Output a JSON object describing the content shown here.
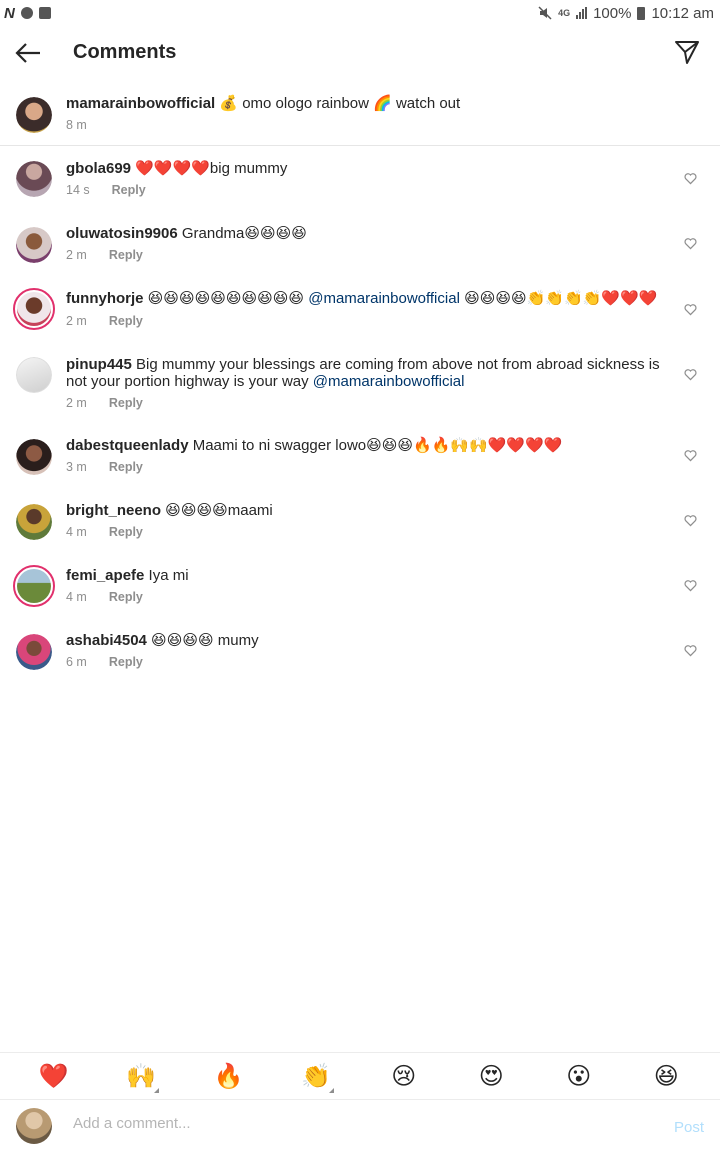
{
  "status_bar": {
    "left_icon_1": "N",
    "network": "4G",
    "battery": "100%",
    "time": "10:12 am"
  },
  "header": {
    "title": "Comments"
  },
  "caption": {
    "username": "mamarainbowofficial",
    "text": " 💰 omo ologo rainbow 🌈 watch out",
    "time": "8 m"
  },
  "comments": [
    {
      "username": "gbola699",
      "text": " ❤️❤️❤️❤️big mummy",
      "time": "14 s",
      "reply": "Reply"
    },
    {
      "username": "oluwatosin9906",
      "text": " Grandma😆😆😆😆",
      "time": "2 m",
      "reply": "Reply"
    },
    {
      "username": "funnyhorje",
      "text": " 😆😆😆😆😆😆😆😆😆😆 ",
      "mention": "@mamarainbowofficial",
      "text_after": " 😆😆😆😆👏👏👏👏❤️❤️❤️",
      "time": "2 m",
      "reply": "Reply"
    },
    {
      "username": "pinup445",
      "text": " Big mummy your blessings are coming from above not from abroad  sickness is not your portion highway is your way ",
      "mention": "@mamarainbowofficial",
      "time": "2 m",
      "reply": "Reply"
    },
    {
      "username": "dabestqueenlady",
      "text": " Maami to ni swagger lowo😆😆😆🔥🔥🙌🙌❤️❤️❤️❤️",
      "time": "3 m",
      "reply": "Reply"
    },
    {
      "username": "bright_neeno",
      "text": " 😆😆😆😆maami",
      "time": "4 m",
      "reply": "Reply"
    },
    {
      "username": "femi_apefe",
      "text": " Iya mi",
      "time": "4 m",
      "reply": "Reply"
    },
    {
      "username": "ashabi4504",
      "text": " 😆😆😆😆 mumy",
      "time": "6 m",
      "reply": "Reply"
    }
  ],
  "emoji_bar": [
    "❤️",
    "🙌",
    "🔥",
    "👏",
    "😢",
    "😍",
    "😮",
    "😆"
  ],
  "input": {
    "placeholder": "Add a comment...",
    "post_label": "Post"
  },
  "colors": {
    "mention": "#003569",
    "meta": "#8e8e8e",
    "post_disabled": "#b2dffc",
    "story_ring": "#e1306c"
  }
}
